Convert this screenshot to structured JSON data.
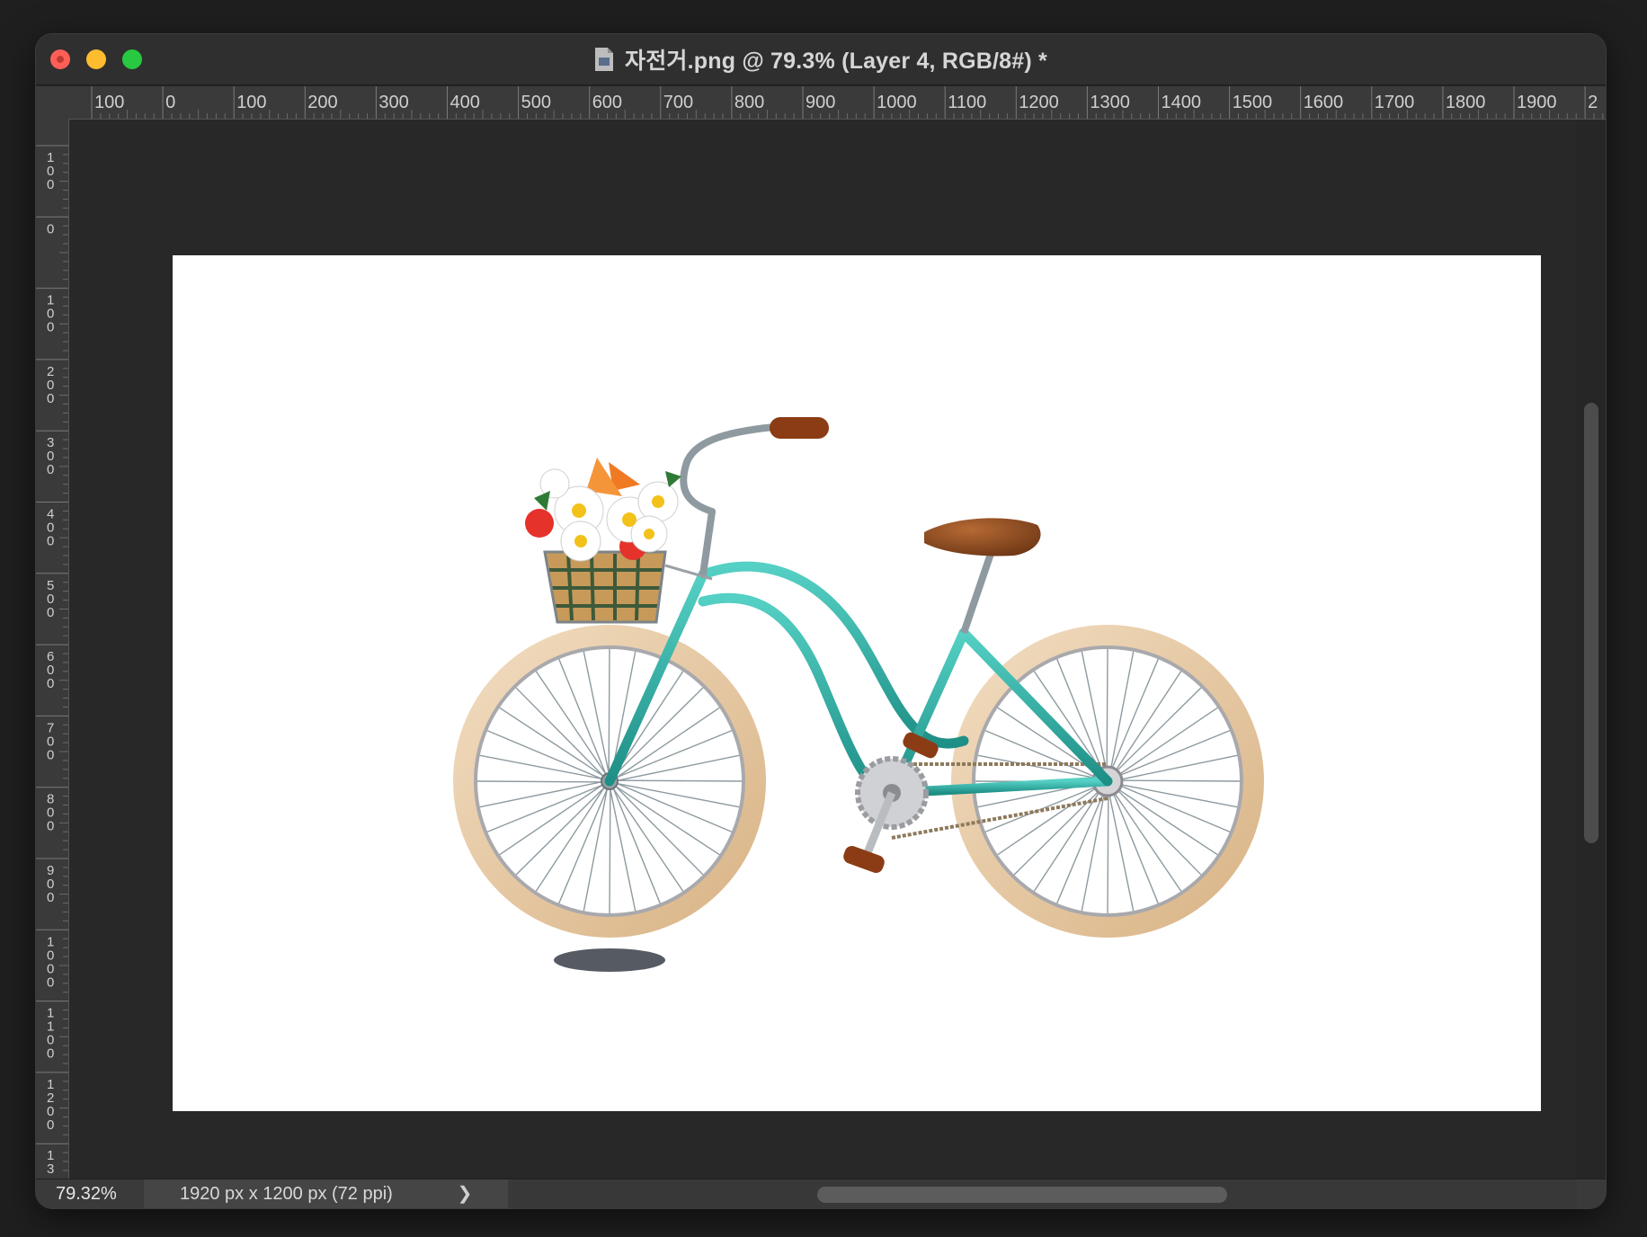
{
  "window": {
    "title": "자전거.png @ 79.3% (Layer 4, RGB/8#) *"
  },
  "ruler_top": {
    "labels": [
      "100",
      "0",
      "100",
      "200",
      "300",
      "400",
      "500",
      "600",
      "700",
      "800",
      "900",
      "1000",
      "1100",
      "1200",
      "1300",
      "1400",
      "1500",
      "1600",
      "1700",
      "1800",
      "1900",
      "2"
    ]
  },
  "ruler_left": {
    "labels": [
      "100",
      "0",
      "100",
      "200",
      "300",
      "400",
      "500",
      "600",
      "700",
      "800",
      "900",
      "1000",
      "1100",
      "1200",
      "13"
    ]
  },
  "status": {
    "zoom": "79.32%",
    "doc_info": "1920 px x 1200 px (72 ppi)",
    "chevron": "❯"
  },
  "colors": {
    "frame": "#2fb3a8",
    "tire": "#e8c9a0",
    "saddle": "#8b4a1f",
    "shadow": "#555a63"
  },
  "icons": {
    "document": "document-icon",
    "close": "close-window-icon",
    "minimize": "minimize-window-icon",
    "maximize": "maximize-window-icon",
    "chevron": "chevron-right-icon"
  }
}
